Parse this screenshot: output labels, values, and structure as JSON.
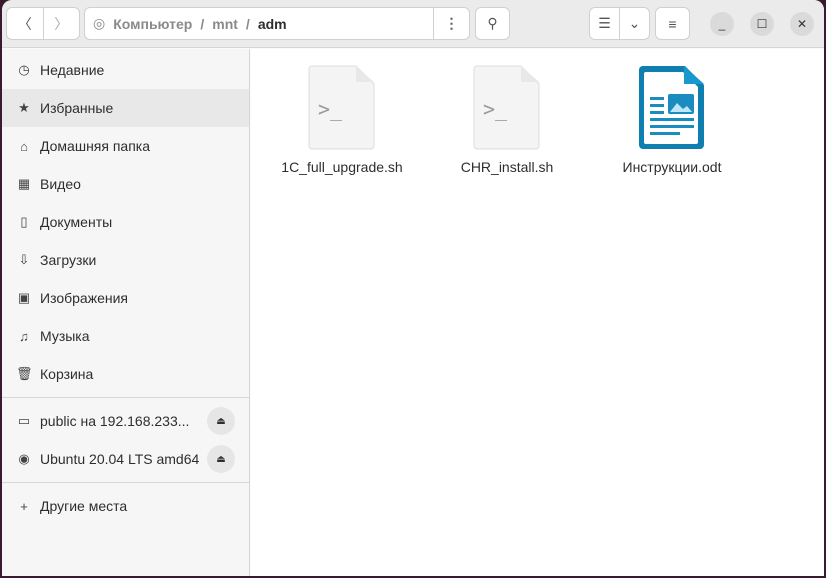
{
  "path": {
    "segments": [
      "Компьютер",
      "mnt"
    ],
    "current": "adm",
    "separator": "/"
  },
  "sidebar": {
    "items": [
      {
        "label": "Недавние",
        "icon": "clock-icon"
      },
      {
        "label": "Избранные",
        "icon": "star-icon"
      },
      {
        "label": "Домашняя папка",
        "icon": "home-icon"
      },
      {
        "label": "Видео",
        "icon": "film-icon"
      },
      {
        "label": "Документы",
        "icon": "document-icon"
      },
      {
        "label": "Загрузки",
        "icon": "download-icon"
      },
      {
        "label": "Изображения",
        "icon": "image-icon"
      },
      {
        "label": "Музыка",
        "icon": "music-icon"
      },
      {
        "label": "Корзина",
        "icon": "trash-icon"
      }
    ],
    "devices": [
      {
        "label": "public на 192.168.233...",
        "icon": "folder-icon"
      },
      {
        "label": "Ubuntu 20.04 LTS amd64",
        "icon": "disc-icon"
      }
    ],
    "other": "Другие места"
  },
  "files": [
    {
      "name": "1C_full_upgrade.sh",
      "type": "script"
    },
    {
      "name": "CHR_install.sh",
      "type": "script"
    },
    {
      "name": "Инструкции.odt",
      "type": "document"
    }
  ]
}
